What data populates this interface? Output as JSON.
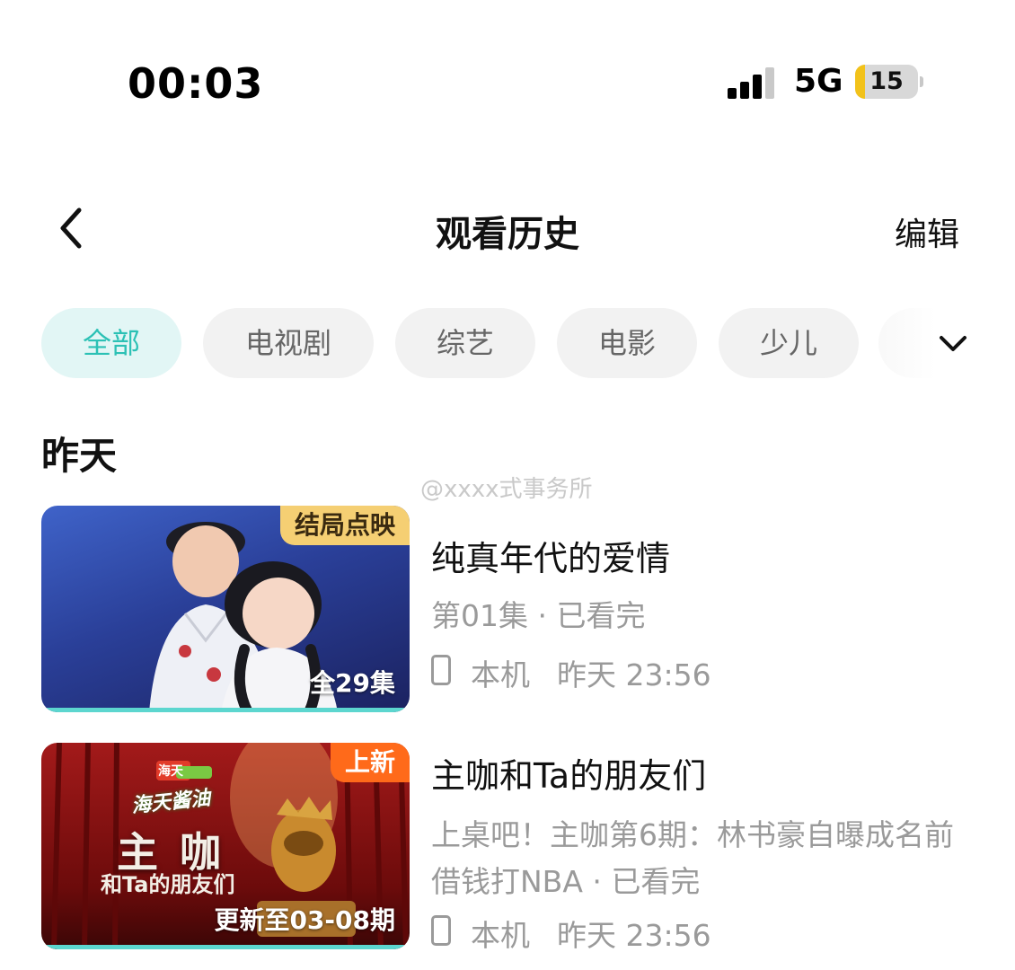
{
  "status_bar": {
    "time": "00:03",
    "network": "5G",
    "battery": "15",
    "battery_level": 0.15
  },
  "nav": {
    "title": "观看历史",
    "edit_label": "编辑"
  },
  "filters": {
    "chips": [
      "全部",
      "电视剧",
      "综艺",
      "电影",
      "少儿"
    ],
    "active_index": 0
  },
  "section_title": "昨天",
  "watermark": "@xxxx式事务所",
  "history": [
    {
      "title": "纯真年代的爱情",
      "progress_text": "第01集 · 已看完",
      "device": "本机",
      "watched_at": "昨天 23:56",
      "badge": "结局点映",
      "episode_label": "全29集"
    },
    {
      "title": "主咖和Ta的朋友们",
      "progress_text": "上桌吧！主咖第6期：林书豪自曝成名前借钱打NBA · 已看完",
      "device": "本机",
      "watched_at": "昨天 23:56",
      "badge": "上新",
      "episode_label": "更新至03-08期",
      "poster_text": {
        "brand": "海天",
        "slogan": "海天酱油",
        "title": "主 咖",
        "subtitle": "和Ta的朋友们"
      }
    }
  ],
  "colors": {
    "accent": "#2cc1b5",
    "chip_bg": "#f2f2f2",
    "badge_yellow": "#f5cf73",
    "badge_orange": "#ff6a1a"
  }
}
